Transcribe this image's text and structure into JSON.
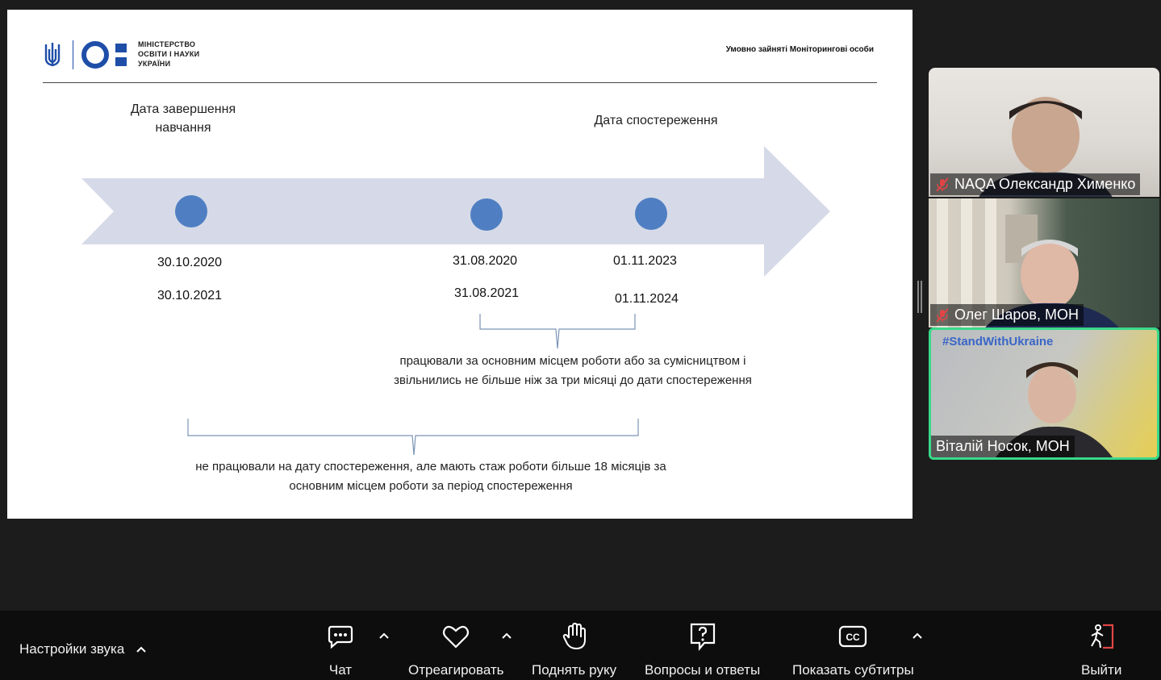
{
  "slide": {
    "ministry_lines": [
      "МІНІСТЕРСТВО",
      "ОСВІТИ І НАУКИ",
      "УКРАЇНИ"
    ],
    "header_note": "Умовно зайняті Моніторингові особи",
    "label_left": "Дата завершення навчання",
    "label_right": "Дата спостереження",
    "dates": {
      "col1_a": "30.10.2020",
      "col1_b": "30.10.2021",
      "col2_a": "31.08.2020",
      "col2_b": "31.08.2021",
      "col3_a": "01.11.2023",
      "col3_b": "01.11.2024"
    },
    "note_upper": "працювали за основним місцем роботи або за сумісництвом і звільнились не більше ніж за три місяці до дати спостереження",
    "note_lower": "не працювали на дату спостереження, але мають стаж роботи більше 18 місяців за основним місцем роботи за період спостереження",
    "colors": {
      "arrow": "#d6dae8",
      "dot": "#4f7fc2",
      "logo_blue": "#1e4ea8"
    }
  },
  "participants": [
    {
      "name": "NAQA Олександр Хименко",
      "muted": true
    },
    {
      "name": "Олег Шаров, МОН",
      "muted": true
    },
    {
      "name": "Віталій Носок, МОН",
      "muted": false,
      "active_speaker": true,
      "overlay_text": "#StandWithUkraine"
    }
  ],
  "toolbar": {
    "audio_settings": "Настройки звука",
    "chat": "Чат",
    "react": "Отреагировать",
    "raise_hand": "Поднять руку",
    "qa": "Вопросы и ответы",
    "captions": "Показать субтитры",
    "leave": "Выйти"
  }
}
